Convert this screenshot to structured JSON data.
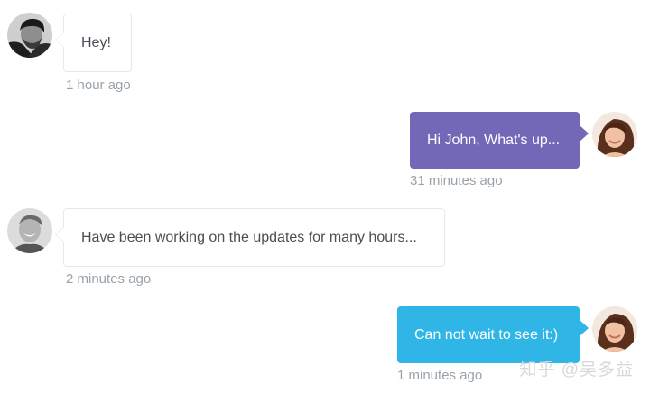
{
  "messages": [
    {
      "side": "left",
      "text": "Hey!",
      "time": "1 hour ago",
      "avatar": "man-dark-hair-avatar"
    },
    {
      "side": "right",
      "text": "Hi John, What's up...",
      "time": "31 minutes ago",
      "avatar": "woman-avatar",
      "color": "#7368b7"
    },
    {
      "side": "left",
      "text": "Have been working on the updates for many hours...",
      "time": "2 minutes ago",
      "avatar": "man-smiling-avatar"
    },
    {
      "side": "right",
      "text": "Can not wait to see it:)",
      "time": "1 minutes ago",
      "avatar": "woman-avatar",
      "color": "#2fb6e6"
    }
  ],
  "watermark": "知乎 @吴多益",
  "colors": {
    "purple_bubble": "#7368b7",
    "blue_bubble": "#2fb6e6",
    "incoming_border": "#e6e8ea",
    "timestamp": "#9aa2a9"
  }
}
